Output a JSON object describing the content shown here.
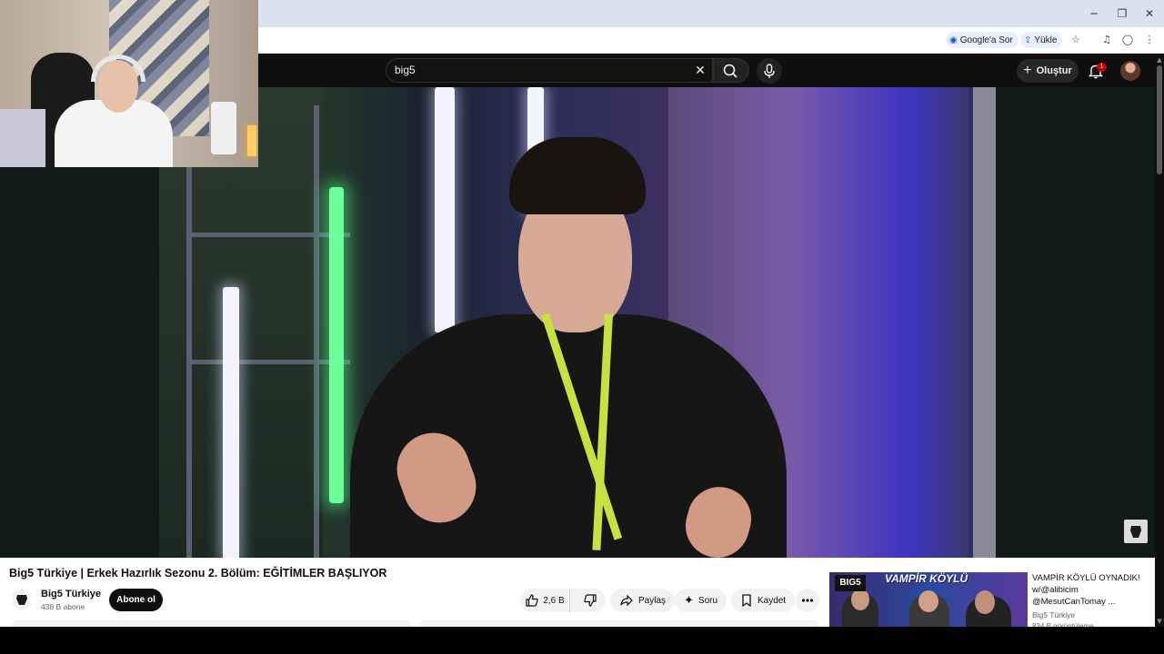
{
  "browser": {
    "window_controls": {
      "minimize": "─",
      "restore": "❐",
      "close": "✕"
    },
    "toolbar": {
      "google_ask_label": "Google'a Sor",
      "upload_label": "Yükle",
      "icons": [
        "star-icon",
        "media-controls-icon",
        "profile-icon",
        "menu-icon"
      ]
    }
  },
  "youtube": {
    "search": {
      "value": "big5"
    },
    "masthead": {
      "create_label": "Oluştur",
      "notification_count": "1"
    }
  },
  "video": {
    "title": "Big5 Türkiye | Erkek Hazırlık Sezonu 2. Bölüm: EĞİTİMLER BAŞLIYOR",
    "channel": {
      "name": "Big5 Türkiye",
      "subscribers": "438 B abone"
    },
    "subscribe_label": "Abone ol",
    "actions": {
      "likes": "2,6 B",
      "share_label": "Paylaş",
      "ask_label": "Soru",
      "save_label": "Kaydet"
    }
  },
  "recommendation": {
    "thumbnail_logo": "BIG5",
    "thumbnail_text": "VAMPİR KÖYLÜ",
    "title": "VAMPİR KÖYLÜ OYNADIK! w/@alibicim @MesutCanTomay ...",
    "channel": "Big5 Türkiye",
    "meta": "834 B görüntüleme"
  },
  "colors": {
    "youtube_dark": "#0f0f0f",
    "badge_red": "#cc0000",
    "tab_strip": "#dbe3f3",
    "neon_green": "#6bff9a"
  }
}
